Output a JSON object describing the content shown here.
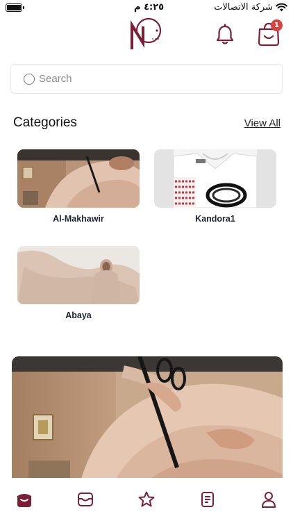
{
  "status_bar": {
    "time": "٤:٢٥ م",
    "carrier": "شركة الاتصالات"
  },
  "header": {
    "logo_icon": "brand-logo-icon",
    "bell_icon": "bell-icon",
    "cart_icon": "shopping-bag-icon",
    "cart_count": "1",
    "accent_color": "#7a1f36",
    "badge_color": "#d9433d"
  },
  "search": {
    "placeholder": "Search"
  },
  "categories": {
    "title": "Categories",
    "view_all": "View All",
    "items": [
      {
        "label": "Al-Makhawir"
      },
      {
        "label": "Kandora1"
      },
      {
        "label": "Abaya"
      }
    ]
  },
  "tabs": [
    {
      "icon": "home-icon",
      "active": true
    },
    {
      "icon": "inbox-icon",
      "active": false
    },
    {
      "icon": "star-icon",
      "active": false
    },
    {
      "icon": "orders-icon",
      "active": false
    },
    {
      "icon": "profile-icon",
      "active": false
    }
  ]
}
